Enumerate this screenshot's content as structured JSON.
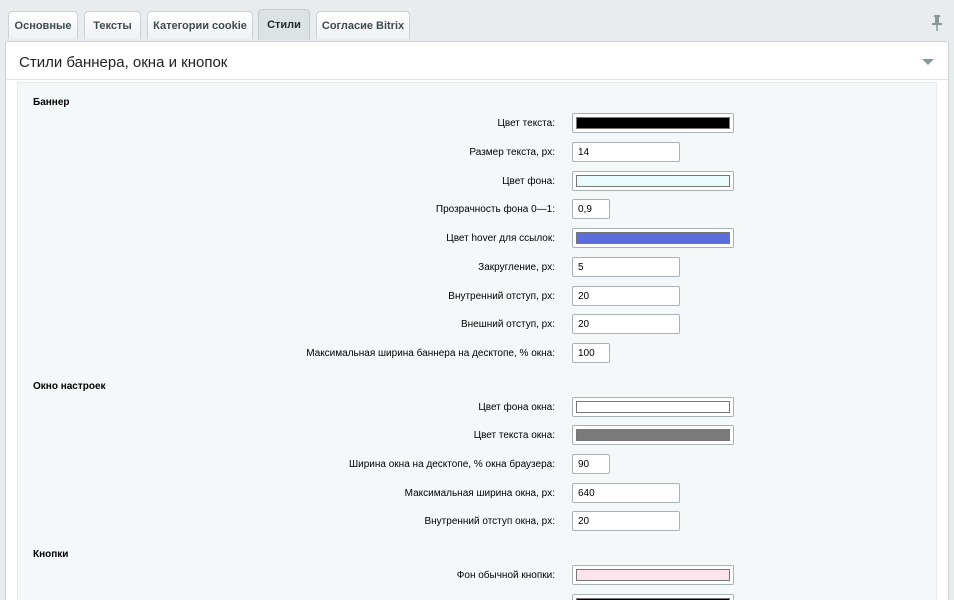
{
  "tabs": [
    {
      "label": "Основные",
      "active": false
    },
    {
      "label": "Тексты",
      "active": false
    },
    {
      "label": "Категории cookie",
      "active": false
    },
    {
      "label": "Стили",
      "active": true
    },
    {
      "label": "Согласие Bitrix",
      "active": false
    }
  ],
  "panel": {
    "title": "Стили баннера, окна и кнопок"
  },
  "sections": {
    "banner": {
      "title": "Баннер",
      "text_color": {
        "label": "Цвет текста:",
        "value": "#000000"
      },
      "font_size": {
        "label": "Размер текста, px:",
        "value": "14"
      },
      "bg_color": {
        "label": "Цвет фона:",
        "value": "#e9fbfb"
      },
      "bg_opacity": {
        "label": "Прозрачность фона 0—1:",
        "value": "0,9"
      },
      "hover_color": {
        "label": "Цвет hover для ссылок:",
        "value": "#5b6ddb"
      },
      "radius": {
        "label": "Закругление, px:",
        "value": "5"
      },
      "padding": {
        "label": "Внутренний отступ, px:",
        "value": "20"
      },
      "margin": {
        "label": "Внешний отступ, px:",
        "value": "20"
      },
      "max_width": {
        "label": "Максимальная ширина баннера на десктопе, % окна:",
        "value": "100"
      }
    },
    "window": {
      "title": "Окно настроек",
      "bg_color": {
        "label": "Цвет фона окна:",
        "value": "#ffffff"
      },
      "text_color": {
        "label": "Цвет текста окна:",
        "value": "#7a7a7a"
      },
      "width": {
        "label": "Ширина окна на десктопе, % окна браузера:",
        "value": "90"
      },
      "max_width": {
        "label": "Максимальная ширина окна, px:",
        "value": "640"
      },
      "padding": {
        "label": "Внутренний отступ окна, px:",
        "value": "20"
      }
    },
    "buttons": {
      "title": "Кнопки",
      "bg_color": {
        "label": "Фон обычной кнопки:",
        "value": "#fde3ec"
      },
      "next_color": {
        "value": "#000000"
      }
    }
  }
}
